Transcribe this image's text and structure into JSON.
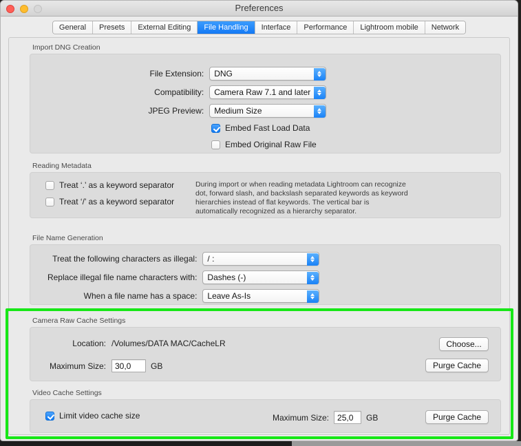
{
  "window": {
    "title": "Preferences",
    "traffic_lights": [
      "close-red",
      "minimize-yellow",
      "zoom-disabled"
    ]
  },
  "tabs": [
    {
      "label": "General",
      "active": false
    },
    {
      "label": "Presets",
      "active": false
    },
    {
      "label": "External Editing",
      "active": false
    },
    {
      "label": "File Handling",
      "active": true
    },
    {
      "label": "Interface",
      "active": false
    },
    {
      "label": "Performance",
      "active": false
    },
    {
      "label": "Lightroom mobile",
      "active": false
    },
    {
      "label": "Network",
      "active": false
    }
  ],
  "import_dng": {
    "group_label": "Import DNG Creation",
    "file_extension_label": "File Extension:",
    "file_extension_value": "DNG",
    "compatibility_label": "Compatibility:",
    "compatibility_value": "Camera Raw 7.1 and later",
    "jpeg_preview_label": "JPEG Preview:",
    "jpeg_preview_value": "Medium Size",
    "embed_fast_load_label": "Embed Fast Load Data",
    "embed_fast_load_checked": true,
    "embed_original_label": "Embed Original Raw File",
    "embed_original_checked": false
  },
  "reading_metadata": {
    "group_label": "Reading Metadata",
    "dot_separator_label": "Treat ‘.’ as a keyword separator",
    "dot_separator_checked": false,
    "slash_separator_label": "Treat ‘/’ as a keyword separator",
    "slash_separator_checked": false,
    "help_text": "During import or when reading metadata Lightroom can recognize dot, forward slash, and backslash separated keywords as keyword hierarchies instead of flat keywords. The vertical bar is automatically recognized as a hierarchy separator."
  },
  "file_name_generation": {
    "group_label": "File Name Generation",
    "illegal_chars_label": "Treat the following characters as illegal:",
    "illegal_chars_value": "/ :",
    "replace_with_label": "Replace illegal file name characters with:",
    "replace_with_value": "Dashes (-)",
    "space_label": "When a file name has a space:",
    "space_value": "Leave As-Is"
  },
  "camera_raw_cache": {
    "group_label": "Camera Raw Cache Settings",
    "location_label": "Location:",
    "location_value": "/Volumes/DATA MAC/CacheLR",
    "choose_button": "Choose...",
    "max_size_label": "Maximum Size:",
    "max_size_value": "30,0",
    "units": "GB",
    "purge_button": "Purge Cache"
  },
  "video_cache": {
    "group_label": "Video Cache Settings",
    "limit_label": "Limit video cache size",
    "limit_checked": true,
    "max_size_label": "Maximum Size:",
    "max_size_value": "25,0",
    "units": "GB",
    "purge_button": "Purge Cache"
  },
  "colors": {
    "accent_blue": "#1479f5",
    "highlight_green": "#17e717",
    "window_bg": "#ececec",
    "group_bg": "#dcdcdc"
  }
}
